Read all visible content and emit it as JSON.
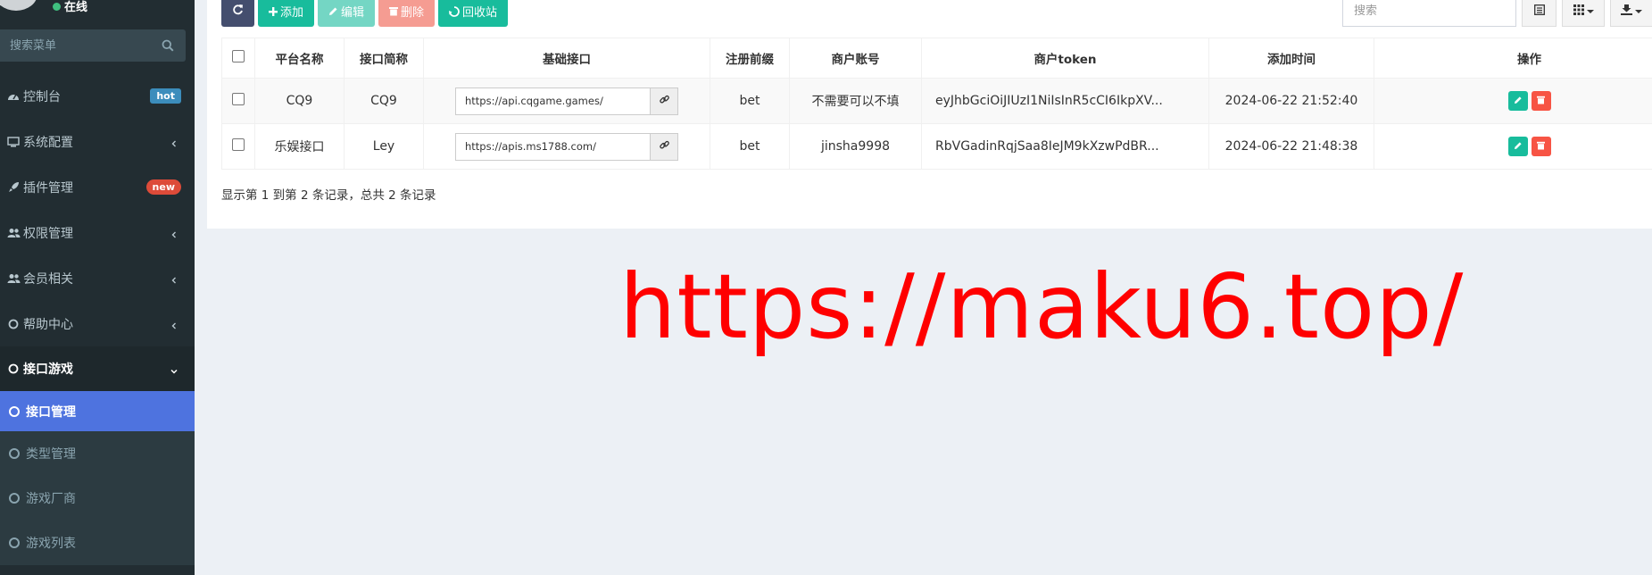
{
  "sidebar": {
    "status": "在线",
    "search_placeholder": "搜索菜单",
    "menu": [
      {
        "label": "控制台",
        "badge": "hot"
      },
      {
        "label": "系统配置"
      },
      {
        "label": "插件管理",
        "badge": "new"
      },
      {
        "label": "权限管理"
      },
      {
        "label": "会员相关"
      },
      {
        "label": "帮助中心"
      },
      {
        "label": "接口游戏"
      }
    ],
    "submenu": [
      {
        "label": "接口管理"
      },
      {
        "label": "类型管理"
      },
      {
        "label": "游戏厂商"
      },
      {
        "label": "游戏列表"
      }
    ]
  },
  "toolbar": {
    "add": "添加",
    "edit": "编辑",
    "delete": "删除",
    "recycle": "回收站",
    "search_placeholder": "搜索"
  },
  "table": {
    "headers": [
      "平台名称",
      "接口简称",
      "基础接口",
      "注册前缀",
      "商户账号",
      "商户token",
      "添加时间",
      "操作"
    ],
    "rows": [
      {
        "platform": "CQ9",
        "short": "CQ9",
        "api": "https://api.cqgame.games/",
        "prefix": "bet",
        "account": "不需要可以不填",
        "token": "eyJhbGciOiJIUzI1NiIsInR5cCI6IkpXV...",
        "time": "2024-06-22 21:52:40"
      },
      {
        "platform": "乐娱接口",
        "short": "Ley",
        "api": "https://apis.ms1788.com/",
        "prefix": "bet",
        "account": "jinsha9998",
        "token": "RbVGadinRqjSaa8IeJM9kXzwPdBR...",
        "time": "2024-06-22 21:48:38"
      }
    ]
  },
  "pagination": {
    "info": "显示第 1 到第 2 条记录，总共 2 条记录"
  },
  "watermark": "https://maku6.top/",
  "colors": {
    "sidebar_bg": "#222d32",
    "active_blue": "#4e73df",
    "success_green": "#18bc9c",
    "danger_red": "#f75444",
    "watermark_red": "#ff0000"
  }
}
